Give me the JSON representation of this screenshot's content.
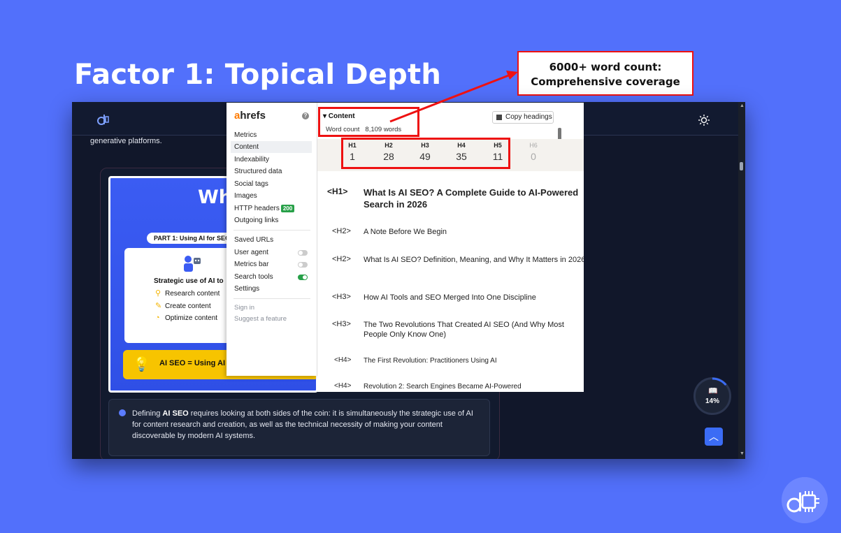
{
  "slide": {
    "title": "Factor 1: Topical Depth",
    "callout_line1": "6000+ word count:",
    "callout_line2": "Comprehensive coverage"
  },
  "page": {
    "intro_text": "generative platforms.",
    "card_heading": "Wh",
    "part_pill": "PART 1: Using AI for SEO",
    "strategic_label": "Strategic use of AI to",
    "checklist": [
      "Research content",
      "Create content",
      "Optimize content"
    ],
    "yellow_text": "AI SEO = Using AI",
    "definition_prefix": "Defining ",
    "definition_bold": "AI SEO",
    "definition_rest": " requires looking at both sides of the coin: it is simultaneously the strategic use of AI for content research and creation, as well as the technical necessity of making your content discoverable by modern AI systems.",
    "progress_label": "14%",
    "progress_value": 0.14
  },
  "ahrefs": {
    "logo_a": "a",
    "logo_rest": "hrefs",
    "help": "?",
    "menu": [
      "Metrics",
      "Content",
      "Indexability",
      "Structured data",
      "Social tags",
      "Images",
      "HTTP headers",
      "Outgoing links"
    ],
    "http_badge": "200",
    "settings_menu": [
      "Saved URLs",
      "User agent",
      "Metrics bar",
      "Search tools",
      "Settings"
    ],
    "footer_menu": [
      "Sign in",
      "Suggest a feature"
    ],
    "content_header": "▾  Content",
    "word_count_label": "Word count",
    "word_count_value": "8,109 words",
    "copy_headings": "Copy headings",
    "heading_counts": [
      {
        "label": "H1",
        "count": "1"
      },
      {
        "label": "H2",
        "count": "28"
      },
      {
        "label": "H3",
        "count": "49"
      },
      {
        "label": "H4",
        "count": "35"
      },
      {
        "label": "H5",
        "count": "11"
      },
      {
        "label": "H6",
        "count": "0"
      }
    ],
    "headings": [
      {
        "tag": "<H1>",
        "text": "What Is AI SEO? A Complete Guide to AI-Powered Search in 2026"
      },
      {
        "tag": "<H2>",
        "text": "A Note Before We Begin"
      },
      {
        "tag": "<H2>",
        "text": "What Is AI SEO? Definition, Meaning, and Why It Matters in 2026"
      },
      {
        "tag": "<H3>",
        "text": "How AI Tools and SEO Merged Into One Discipline"
      },
      {
        "tag": "<H3>",
        "text": "The Two Revolutions That Created AI SEO (And Why Most People Only Know One)"
      },
      {
        "tag": "<H4>",
        "text": "The First Revolution: Practitioners Using AI"
      },
      {
        "tag": "<H4>",
        "text": "Revolution 2: Search Engines Became AI-Powered"
      }
    ]
  },
  "colors": {
    "slide_bg": "#5270fb",
    "highlight": "#e11111",
    "ahrefs_orange": "#ff7a00",
    "toggle_on": "#27a048"
  },
  "icons": [
    "site-logo-icon",
    "theme-sun-icon",
    "robot-icon",
    "search-icon",
    "edit-icon",
    "gauge-icon",
    "lightbulb-icon",
    "info-icon",
    "book-icon",
    "chevron-up-icon",
    "help-icon",
    "copy-icon",
    "corner-ai-logo-icon"
  ]
}
